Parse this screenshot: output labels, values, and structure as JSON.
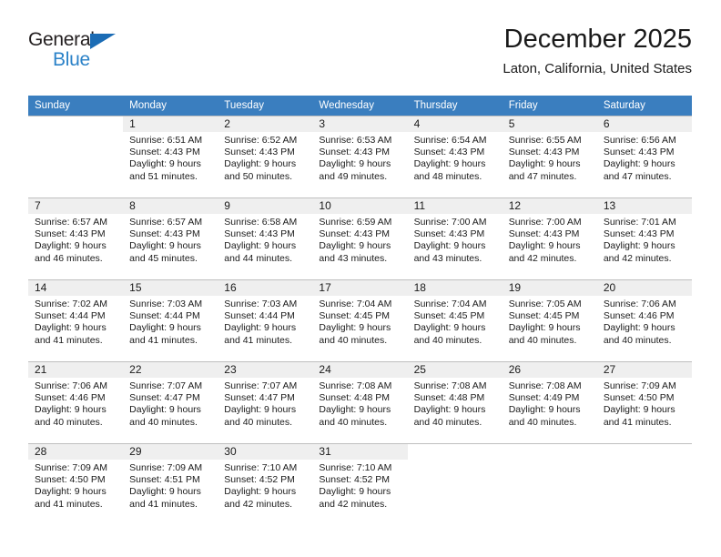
{
  "brand": {
    "name_top": "General",
    "name_bottom": "Blue",
    "triangle_color": "#1b6cb5",
    "blue_text_color": "#2b82c8"
  },
  "header": {
    "month_title": "December 2025",
    "location": "Laton, California, United States"
  },
  "theme": {
    "header_bg": "#3a7ebf",
    "header_text": "#ffffff",
    "daynum_band_bg": "#efefef",
    "grid_line": "#bfbfbf",
    "page_bg": "#ffffff"
  },
  "calendar": {
    "weekday_headers": [
      "Sunday",
      "Monday",
      "Tuesday",
      "Wednesday",
      "Thursday",
      "Friday",
      "Saturday"
    ],
    "weeks": [
      [
        {
          "day": "",
          "lines": []
        },
        {
          "day": "1",
          "lines": [
            "Sunrise: 6:51 AM",
            "Sunset: 4:43 PM",
            "Daylight: 9 hours",
            "and 51 minutes."
          ]
        },
        {
          "day": "2",
          "lines": [
            "Sunrise: 6:52 AM",
            "Sunset: 4:43 PM",
            "Daylight: 9 hours",
            "and 50 minutes."
          ]
        },
        {
          "day": "3",
          "lines": [
            "Sunrise: 6:53 AM",
            "Sunset: 4:43 PM",
            "Daylight: 9 hours",
            "and 49 minutes."
          ]
        },
        {
          "day": "4",
          "lines": [
            "Sunrise: 6:54 AM",
            "Sunset: 4:43 PM",
            "Daylight: 9 hours",
            "and 48 minutes."
          ]
        },
        {
          "day": "5",
          "lines": [
            "Sunrise: 6:55 AM",
            "Sunset: 4:43 PM",
            "Daylight: 9 hours",
            "and 47 minutes."
          ]
        },
        {
          "day": "6",
          "lines": [
            "Sunrise: 6:56 AM",
            "Sunset: 4:43 PM",
            "Daylight: 9 hours",
            "and 47 minutes."
          ]
        }
      ],
      [
        {
          "day": "7",
          "lines": [
            "Sunrise: 6:57 AM",
            "Sunset: 4:43 PM",
            "Daylight: 9 hours",
            "and 46 minutes."
          ]
        },
        {
          "day": "8",
          "lines": [
            "Sunrise: 6:57 AM",
            "Sunset: 4:43 PM",
            "Daylight: 9 hours",
            "and 45 minutes."
          ]
        },
        {
          "day": "9",
          "lines": [
            "Sunrise: 6:58 AM",
            "Sunset: 4:43 PM",
            "Daylight: 9 hours",
            "and 44 minutes."
          ]
        },
        {
          "day": "10",
          "lines": [
            "Sunrise: 6:59 AM",
            "Sunset: 4:43 PM",
            "Daylight: 9 hours",
            "and 43 minutes."
          ]
        },
        {
          "day": "11",
          "lines": [
            "Sunrise: 7:00 AM",
            "Sunset: 4:43 PM",
            "Daylight: 9 hours",
            "and 43 minutes."
          ]
        },
        {
          "day": "12",
          "lines": [
            "Sunrise: 7:00 AM",
            "Sunset: 4:43 PM",
            "Daylight: 9 hours",
            "and 42 minutes."
          ]
        },
        {
          "day": "13",
          "lines": [
            "Sunrise: 7:01 AM",
            "Sunset: 4:43 PM",
            "Daylight: 9 hours",
            "and 42 minutes."
          ]
        }
      ],
      [
        {
          "day": "14",
          "lines": [
            "Sunrise: 7:02 AM",
            "Sunset: 4:44 PM",
            "Daylight: 9 hours",
            "and 41 minutes."
          ]
        },
        {
          "day": "15",
          "lines": [
            "Sunrise: 7:03 AM",
            "Sunset: 4:44 PM",
            "Daylight: 9 hours",
            "and 41 minutes."
          ]
        },
        {
          "day": "16",
          "lines": [
            "Sunrise: 7:03 AM",
            "Sunset: 4:44 PM",
            "Daylight: 9 hours",
            "and 41 minutes."
          ]
        },
        {
          "day": "17",
          "lines": [
            "Sunrise: 7:04 AM",
            "Sunset: 4:45 PM",
            "Daylight: 9 hours",
            "and 40 minutes."
          ]
        },
        {
          "day": "18",
          "lines": [
            "Sunrise: 7:04 AM",
            "Sunset: 4:45 PM",
            "Daylight: 9 hours",
            "and 40 minutes."
          ]
        },
        {
          "day": "19",
          "lines": [
            "Sunrise: 7:05 AM",
            "Sunset: 4:45 PM",
            "Daylight: 9 hours",
            "and 40 minutes."
          ]
        },
        {
          "day": "20",
          "lines": [
            "Sunrise: 7:06 AM",
            "Sunset: 4:46 PM",
            "Daylight: 9 hours",
            "and 40 minutes."
          ]
        }
      ],
      [
        {
          "day": "21",
          "lines": [
            "Sunrise: 7:06 AM",
            "Sunset: 4:46 PM",
            "Daylight: 9 hours",
            "and 40 minutes."
          ]
        },
        {
          "day": "22",
          "lines": [
            "Sunrise: 7:07 AM",
            "Sunset: 4:47 PM",
            "Daylight: 9 hours",
            "and 40 minutes."
          ]
        },
        {
          "day": "23",
          "lines": [
            "Sunrise: 7:07 AM",
            "Sunset: 4:47 PM",
            "Daylight: 9 hours",
            "and 40 minutes."
          ]
        },
        {
          "day": "24",
          "lines": [
            "Sunrise: 7:08 AM",
            "Sunset: 4:48 PM",
            "Daylight: 9 hours",
            "and 40 minutes."
          ]
        },
        {
          "day": "25",
          "lines": [
            "Sunrise: 7:08 AM",
            "Sunset: 4:48 PM",
            "Daylight: 9 hours",
            "and 40 minutes."
          ]
        },
        {
          "day": "26",
          "lines": [
            "Sunrise: 7:08 AM",
            "Sunset: 4:49 PM",
            "Daylight: 9 hours",
            "and 40 minutes."
          ]
        },
        {
          "day": "27",
          "lines": [
            "Sunrise: 7:09 AM",
            "Sunset: 4:50 PM",
            "Daylight: 9 hours",
            "and 41 minutes."
          ]
        }
      ],
      [
        {
          "day": "28",
          "lines": [
            "Sunrise: 7:09 AM",
            "Sunset: 4:50 PM",
            "Daylight: 9 hours",
            "and 41 minutes."
          ]
        },
        {
          "day": "29",
          "lines": [
            "Sunrise: 7:09 AM",
            "Sunset: 4:51 PM",
            "Daylight: 9 hours",
            "and 41 minutes."
          ]
        },
        {
          "day": "30",
          "lines": [
            "Sunrise: 7:10 AM",
            "Sunset: 4:52 PM",
            "Daylight: 9 hours",
            "and 42 minutes."
          ]
        },
        {
          "day": "31",
          "lines": [
            "Sunrise: 7:10 AM",
            "Sunset: 4:52 PM",
            "Daylight: 9 hours",
            "and 42 minutes."
          ]
        },
        {
          "day": "",
          "lines": []
        },
        {
          "day": "",
          "lines": []
        },
        {
          "day": "",
          "lines": []
        }
      ]
    ]
  }
}
